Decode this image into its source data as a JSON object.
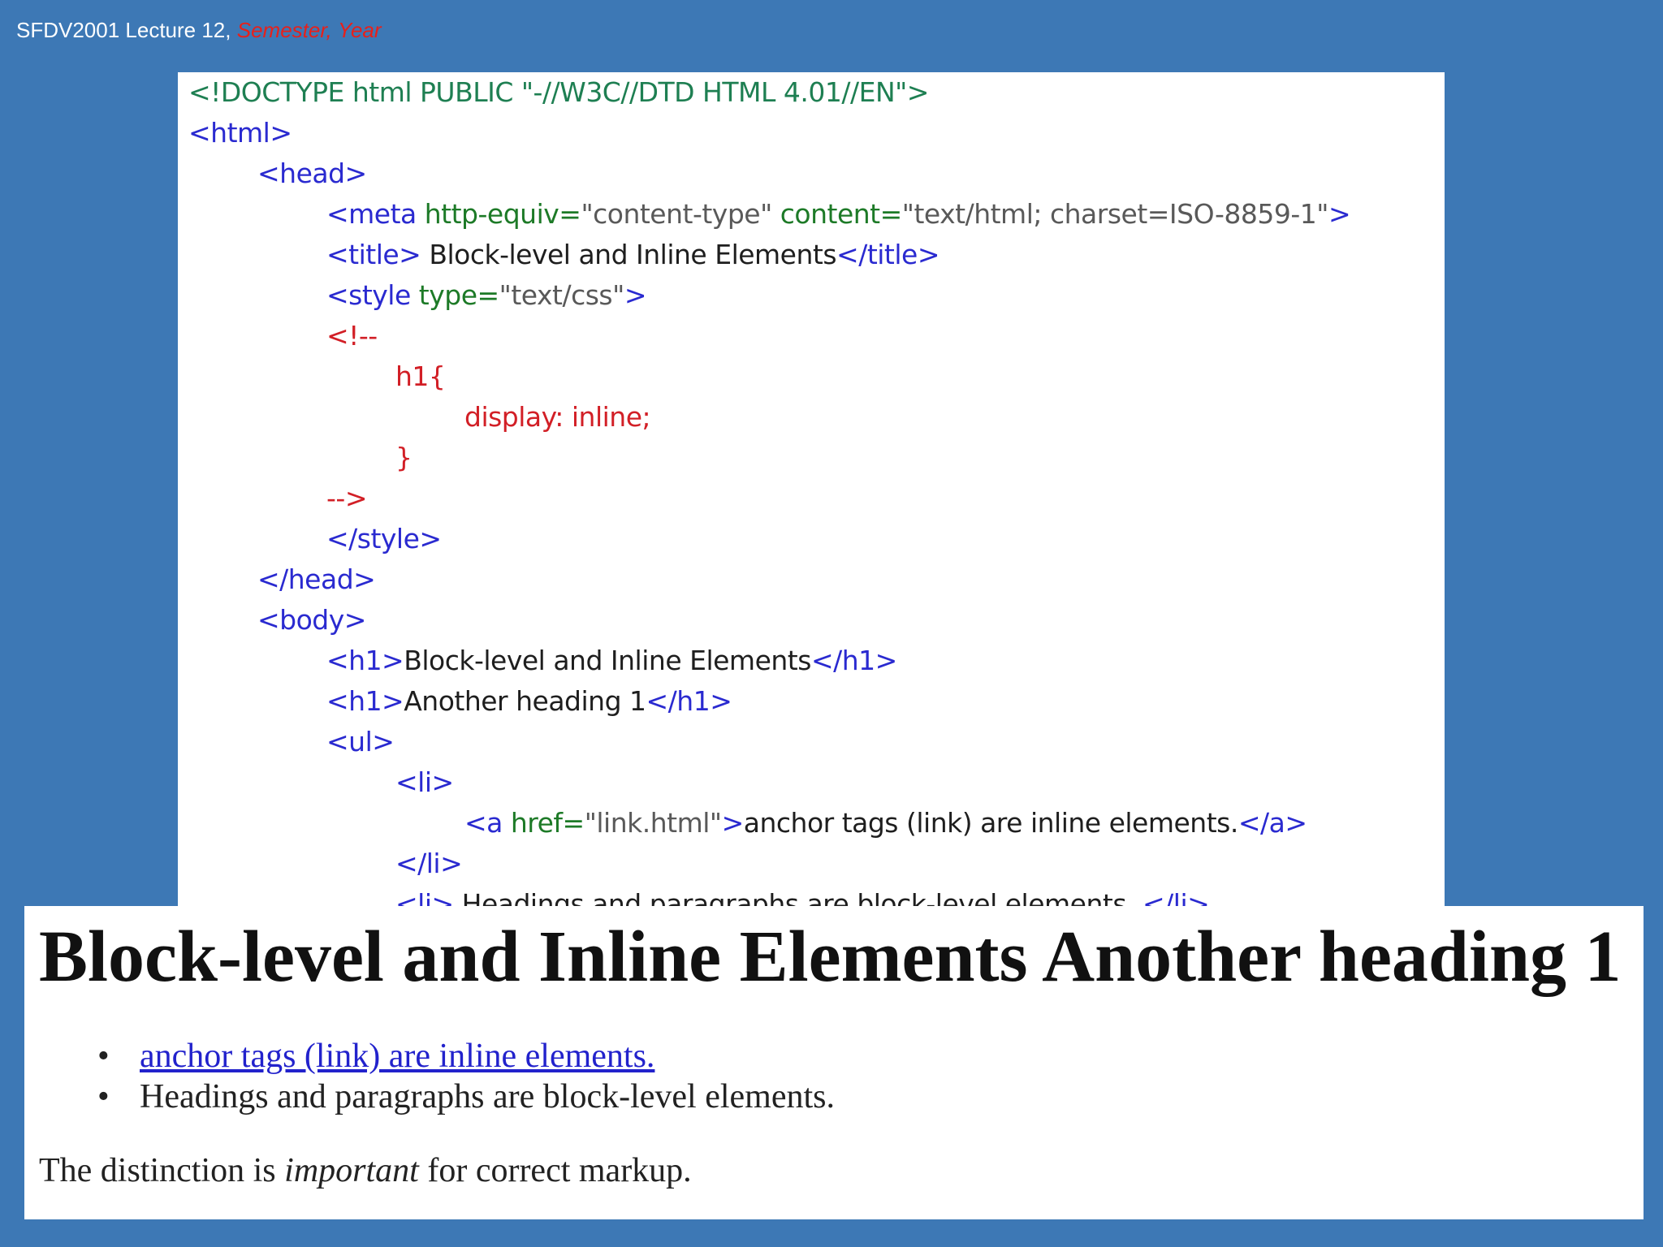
{
  "header": {
    "course": "SFDV2001 Lecture 12,",
    "semester": "Semester,",
    "year": "Year"
  },
  "code": {
    "doctype": "<!DOCTYPE html PUBLIC \"-//W3C//DTD HTML 4.01//EN\">",
    "html_open": "<html>",
    "head_open": "<head>",
    "meta": {
      "tag_open": "<meta",
      "attr1": "http-equiv=",
      "val1": "\"content-type\"",
      "attr2": "content=",
      "val2": "\"text/html; charset=ISO-8859-1\"",
      "tag_close": ">"
    },
    "title": {
      "open": "<title>",
      "text": "Block-level and Inline Elements",
      "close": "</title>"
    },
    "style_open": {
      "tag": "<style",
      "attr": "type=",
      "val": "\"text/css\"",
      "close": ">"
    },
    "comment_open": "<!--",
    "css_selector": "h1{",
    "css_declaration": "display: inline;",
    "css_close": "}",
    "comment_close": "-->",
    "style_close": "</style>",
    "head_close": "</head>",
    "body_open": "<body>",
    "h1_first": {
      "open": "<h1>",
      "text": "Block-level and Inline Elements",
      "close": "</h1>"
    },
    "h1_second": {
      "open": "<h1>",
      "text": "Another heading 1",
      "close": "</h1>"
    },
    "ul_open": "<ul>",
    "li_open": "<li>",
    "anchor": {
      "open": "<a",
      "attr": "href=",
      "val": "\"link.html\"",
      "gt": ">",
      "text": "anchor tags (link) are inline elements.",
      "close": "</a>"
    },
    "li_close": "</li>",
    "li_partial": {
      "open": "<li>",
      "text": "Headings and paragraphs are block-level elements.",
      "close": "</li>"
    }
  },
  "render": {
    "heading": "Block-level and Inline Elements Another heading 1",
    "bullet": "•",
    "items": [
      "anchor tags (link) are inline elements.",
      "Headings and paragraphs are block-level elements."
    ],
    "para_before": "The distinction is ",
    "para_em": "important",
    "para_after": " for correct markup."
  },
  "colors": {
    "background": "#3d78b5",
    "tag": "#2a2ad0",
    "attribute": "#1d7a27",
    "value": "#595959",
    "css": "#d21f26",
    "link": "#2222cc"
  }
}
